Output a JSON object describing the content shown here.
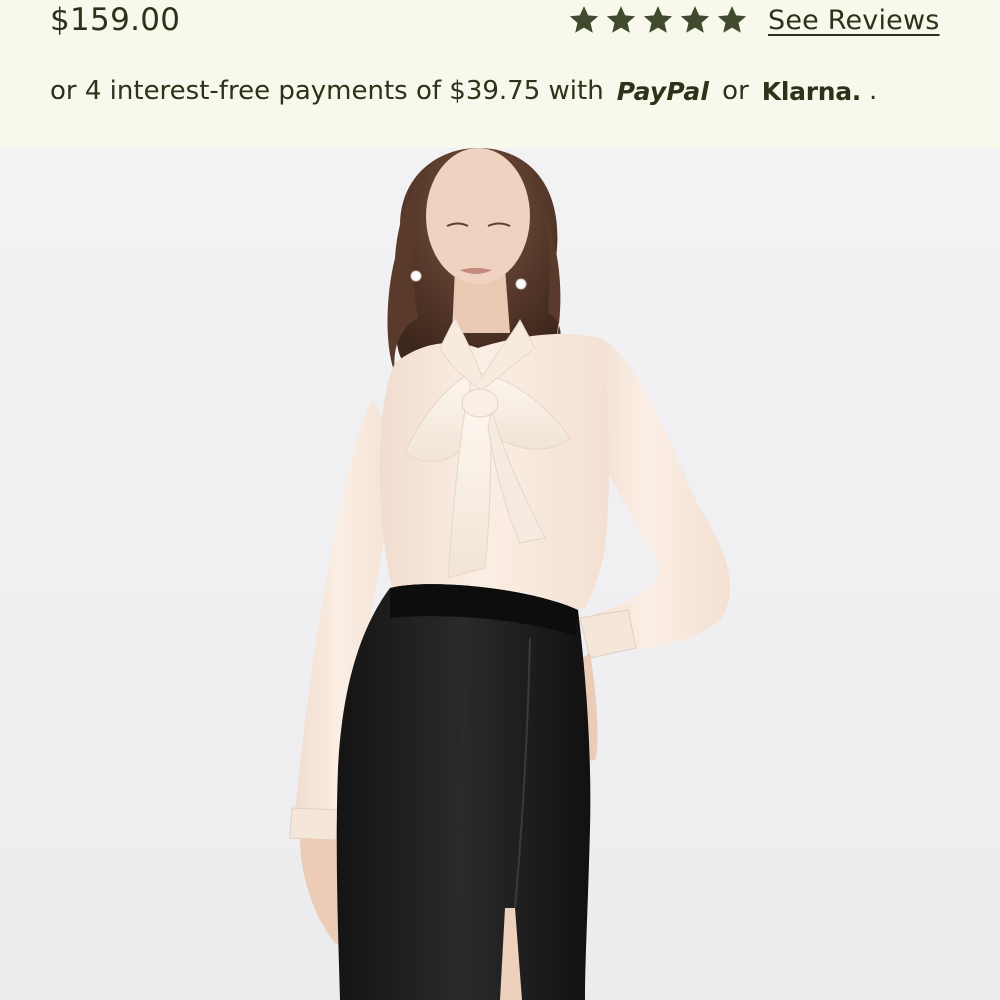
{
  "product": {
    "price": "$159.00",
    "rating": {
      "stars": 5,
      "see_reviews_label": "See Reviews"
    },
    "installments": {
      "prefix": "or 4 interest-free payments of $39.75 with",
      "paypal_logo": "PayPal",
      "or_label": "or",
      "klarna_logo": "Klarna.",
      "suffix": "."
    },
    "image": {
      "alt": "Model wearing a champagne silk tie-neck blouse with black satin pencil skirt"
    }
  },
  "colors": {
    "panel_bg": "#f8f8ec",
    "text": "#2b3319",
    "star": "#3f4a2e",
    "photo_bg": "#f1f1f3"
  },
  "icons": [
    "star-icon",
    "paypal-logo",
    "klarna-logo"
  ]
}
